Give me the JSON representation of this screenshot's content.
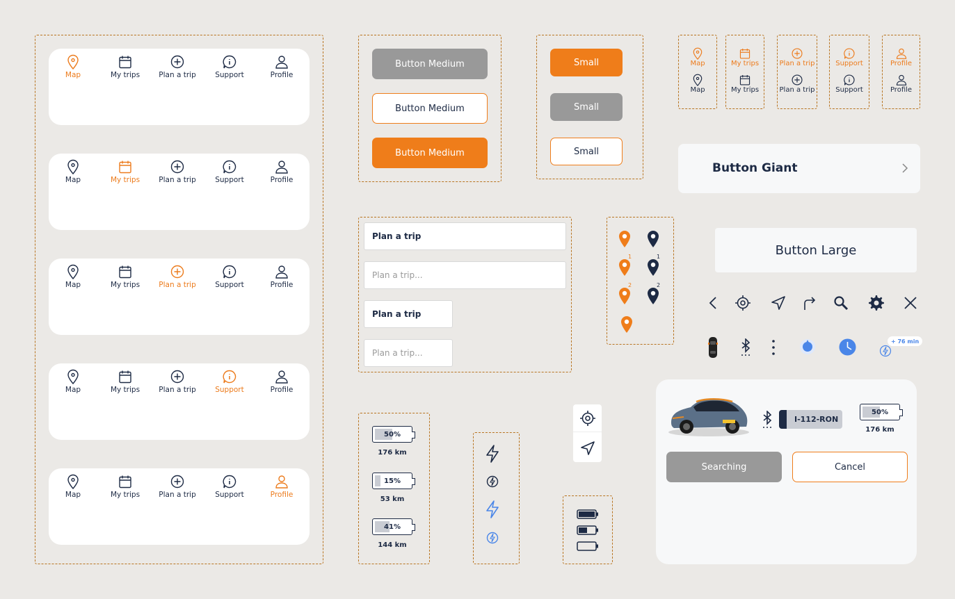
{
  "nav_labels": {
    "map": "Map",
    "trips": "My trips",
    "plan": "Plan a trip",
    "support": "Support",
    "profile": "Profile"
  },
  "buttons_medium": {
    "gray": "Button Medium",
    "outline": "Button Medium",
    "orange": "Button Medium"
  },
  "buttons_small": {
    "orange": "Small",
    "gray": "Small",
    "outline": "Small"
  },
  "button_giant": "Button Giant",
  "button_large": "Button Large",
  "inputs": {
    "filled": "Plan a trip",
    "placeholder": "Plan a trip...",
    "filled_small": "Plan a trip",
    "placeholder_small": "Plan a trip..."
  },
  "pins": {
    "one": "1",
    "two": "2"
  },
  "batteries": [
    {
      "percent": "50%",
      "range": "176 km",
      "level": 0.5
    },
    {
      "percent": "15%",
      "range": "53 km",
      "level": 0.15
    },
    {
      "percent": "41%",
      "range": "144 km",
      "level": 0.41
    }
  ],
  "badge_time": "+ 76 min",
  "car_card": {
    "plate": "I-112-RON",
    "battery_percent": "50%",
    "battery_level": 0.5,
    "range": "176 km",
    "searching_label": "Searching",
    "cancel_label": "Cancel"
  },
  "colors": {
    "accent": "#ef7d1a",
    "navy": "#1d2a44",
    "blue": "#4a86e8",
    "gray": "#999999"
  }
}
